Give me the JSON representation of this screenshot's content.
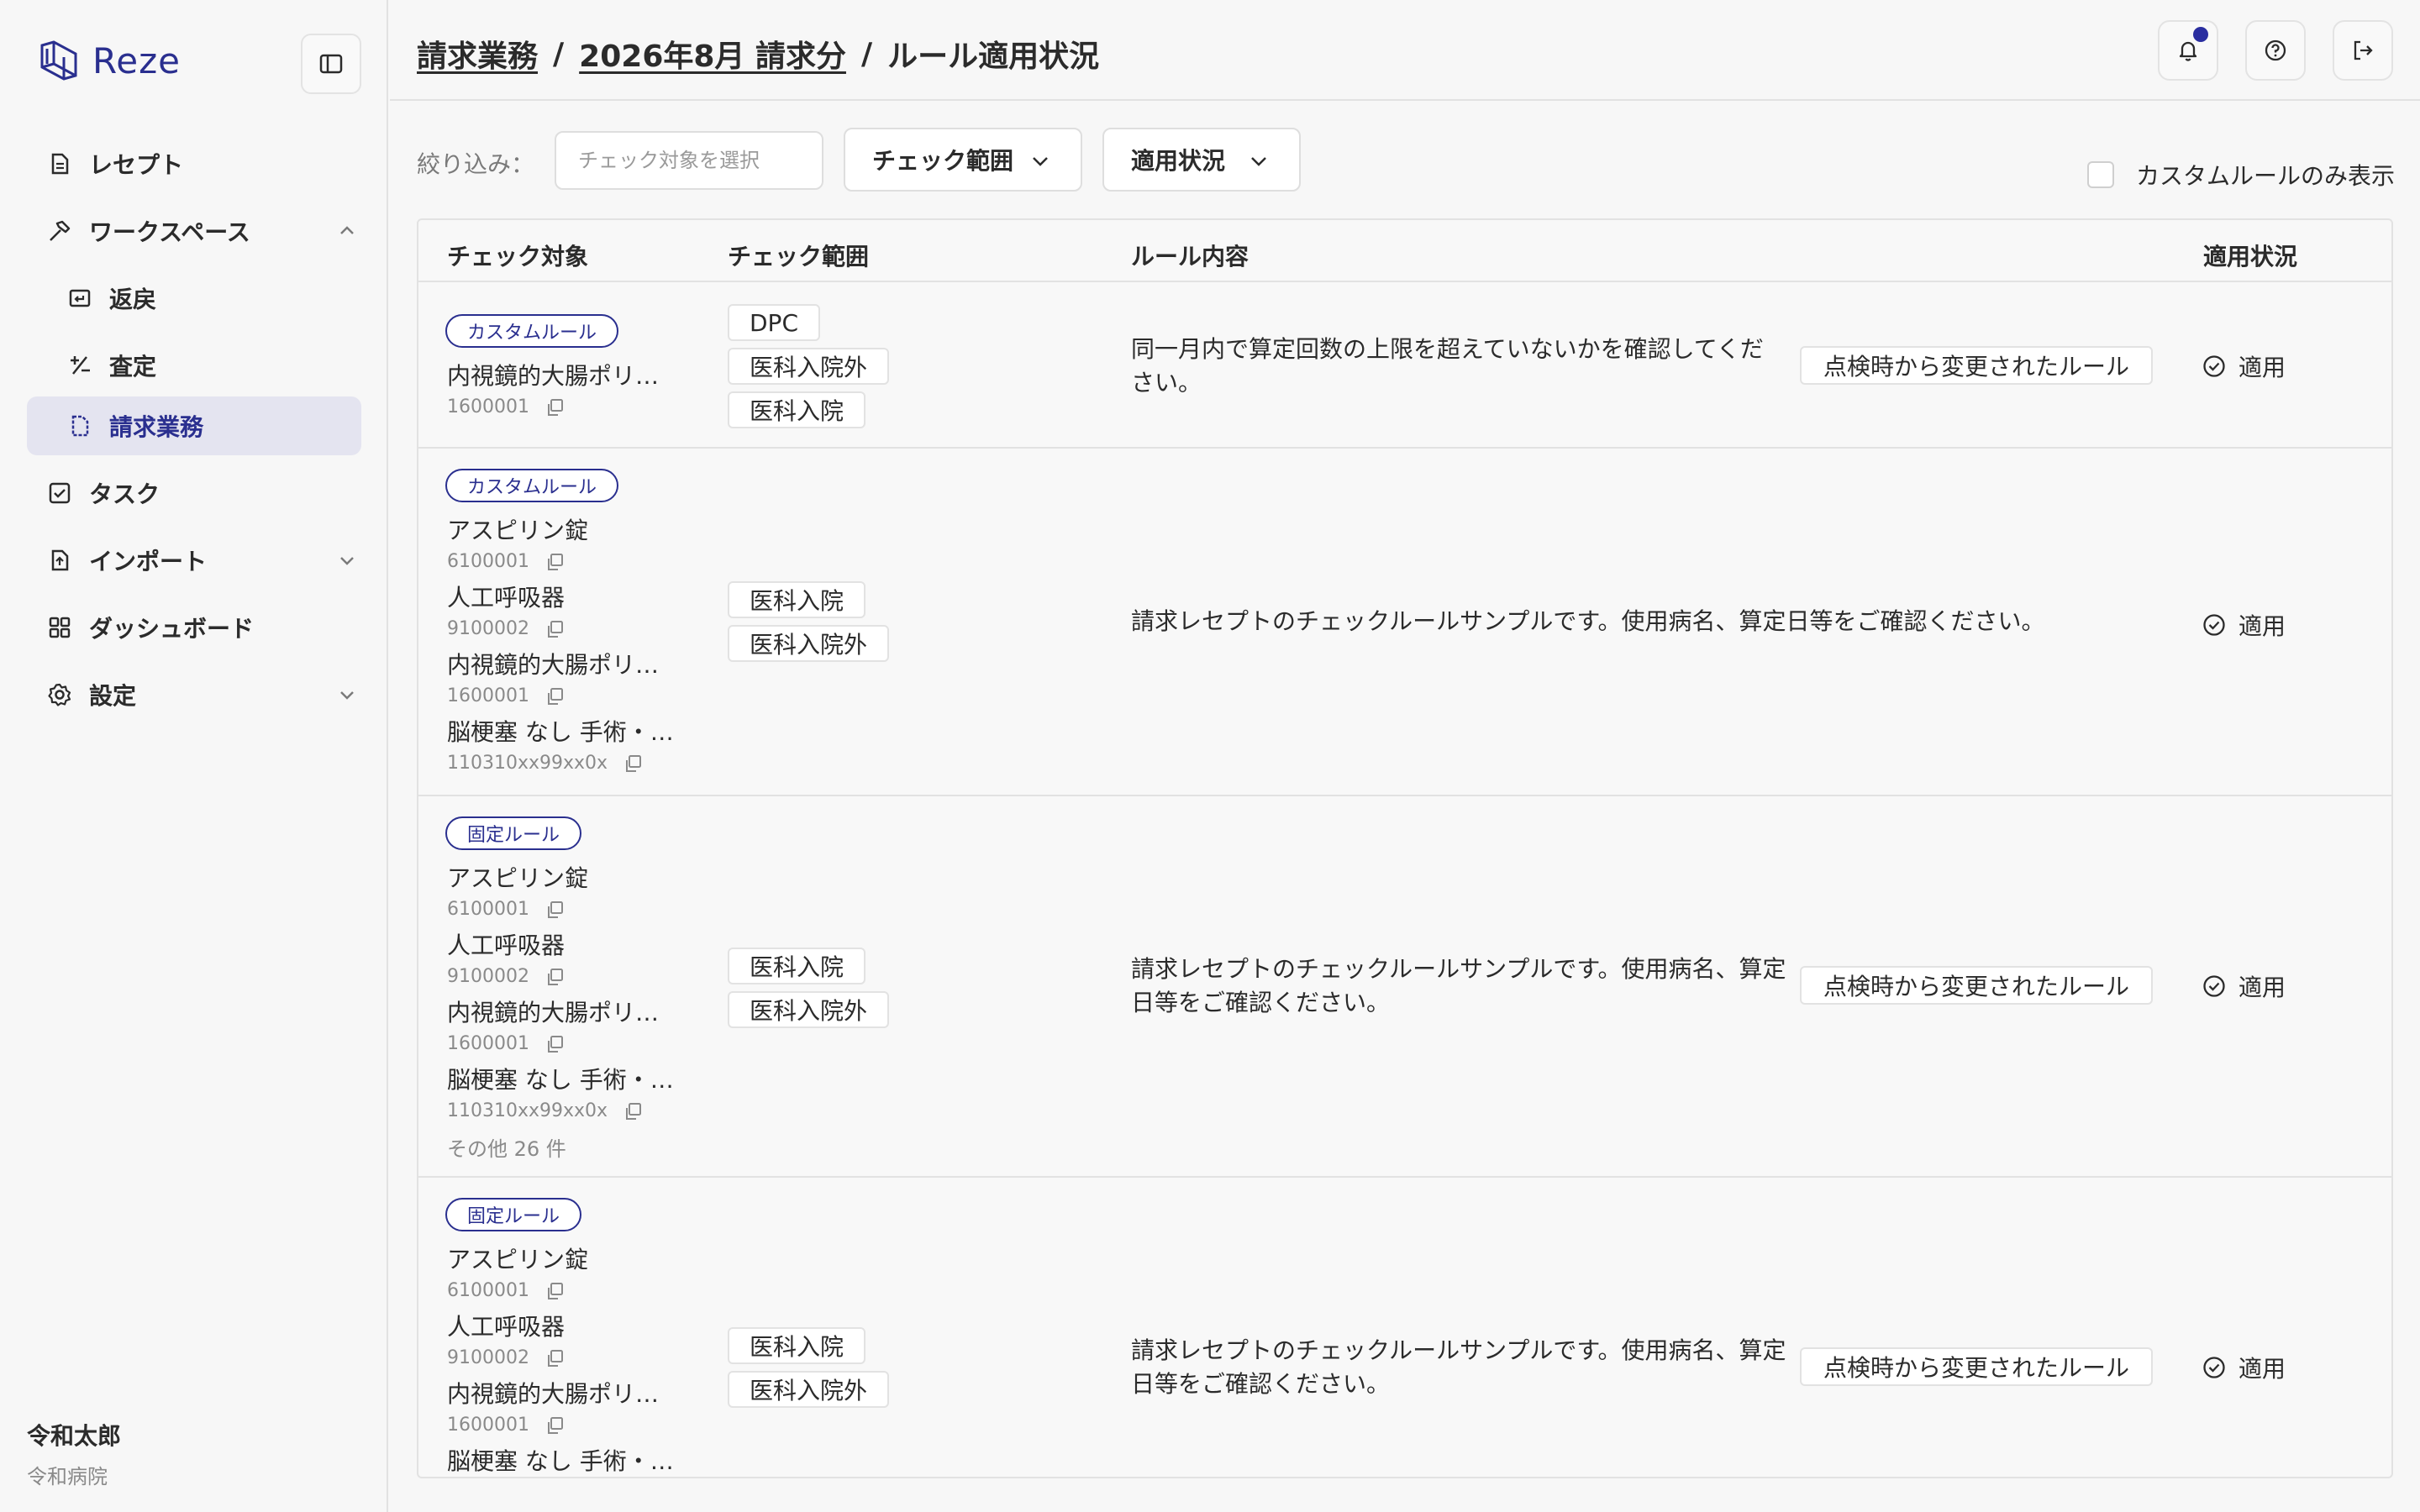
{
  "app": {
    "name": "Reze"
  },
  "sidebar": {
    "items": [
      {
        "label": "レセプト"
      },
      {
        "label": "ワークスペース"
      },
      {
        "label": "返戻"
      },
      {
        "label": "査定"
      },
      {
        "label": "請求業務"
      },
      {
        "label": "タスク"
      },
      {
        "label": "インポート"
      },
      {
        "label": "ダッシュボード"
      },
      {
        "label": "設定"
      }
    ],
    "user": {
      "name": "令和太郎",
      "org": "令和病院"
    }
  },
  "header": {
    "breadcrumb": [
      "請求業務",
      "2026年8月 請求分",
      "ルール適用状況"
    ],
    "separator": "/"
  },
  "filters": {
    "label": "絞り込み：",
    "target_placeholder": "チェック対象を選択",
    "scope_label": "チェック範囲",
    "status_label": "適用状況",
    "custom_only_label": "カスタムルールのみ表示"
  },
  "table": {
    "columns": [
      "チェック対象",
      "チェック範囲",
      "ルール内容",
      "適用状況"
    ],
    "rows": [
      {
        "tag": "カスタムルール",
        "targets": [
          {
            "name": "内視鏡的大腸ポリ…",
            "code": "1600001"
          }
        ],
        "scopes": [
          "DPC",
          "医科入院外",
          "医科入院"
        ],
        "rule": "同一月内で算定回数の上限を超えていないかを確認してください。",
        "changed": "点検時から変更されたルール",
        "status": "適用"
      },
      {
        "tag": "カスタムルール",
        "targets": [
          {
            "name": "アスピリン錠",
            "code": "6100001"
          },
          {
            "name": "人工呼吸器",
            "code": "9100002"
          },
          {
            "name": "内視鏡的大腸ポリ…",
            "code": "1600001"
          },
          {
            "name": "脳梗塞 なし 手術・…",
            "code": "110310xx99xx0x"
          }
        ],
        "scopes": [
          "医科入院",
          "医科入院外"
        ],
        "rule": "請求レセプトのチェックルールサンプルです。使用病名、算定日等をご確認ください。",
        "changed": "",
        "status": "適用"
      },
      {
        "tag": "固定ルール",
        "targets": [
          {
            "name": "アスピリン錠",
            "code": "6100001"
          },
          {
            "name": "人工呼吸器",
            "code": "9100002"
          },
          {
            "name": "内視鏡的大腸ポリ…",
            "code": "1600001"
          },
          {
            "name": "脳梗塞 なし 手術・…",
            "code": "110310xx99xx0x"
          }
        ],
        "more": "その他 26 件",
        "scopes": [
          "医科入院",
          "医科入院外"
        ],
        "rule": "請求レセプトのチェックルールサンプルです。使用病名、算定日等をご確認ください。",
        "changed": "点検時から変更されたルール",
        "status": "適用"
      },
      {
        "tag": "固定ルール",
        "targets": [
          {
            "name": "アスピリン錠",
            "code": "6100001"
          },
          {
            "name": "人工呼吸器",
            "code": "9100002"
          },
          {
            "name": "内視鏡的大腸ポリ…",
            "code": "1600001"
          },
          {
            "name": "脳梗塞 なし 手術・…",
            "code": ""
          }
        ],
        "scopes": [
          "医科入院",
          "医科入院外"
        ],
        "rule": "請求レセプトのチェックルールサンプルです。使用病名、算定日等をご確認ください。",
        "changed": "点検時から変更されたルール",
        "status": "適用"
      }
    ]
  },
  "colors": {
    "accent": "#2a2f8f",
    "active_bg": "#e4e4f0",
    "border": "#e2e2e2",
    "notification_dot": "#2a2ea0"
  },
  "icons": {
    "logo": "reze-logo-icon",
    "sidebar_toggle": "sidebar-toggle-icon",
    "nav": [
      "document-icon",
      "hammer-icon",
      "return-icon",
      "plus-minus-icon",
      "invoice-icon",
      "checkbox-icon",
      "file-import-icon",
      "dashboard-icon",
      "gear-icon"
    ],
    "header": [
      "bell-icon",
      "help-icon",
      "logout-icon"
    ],
    "copy": "copy-icon",
    "status": "check-circle-icon"
  }
}
